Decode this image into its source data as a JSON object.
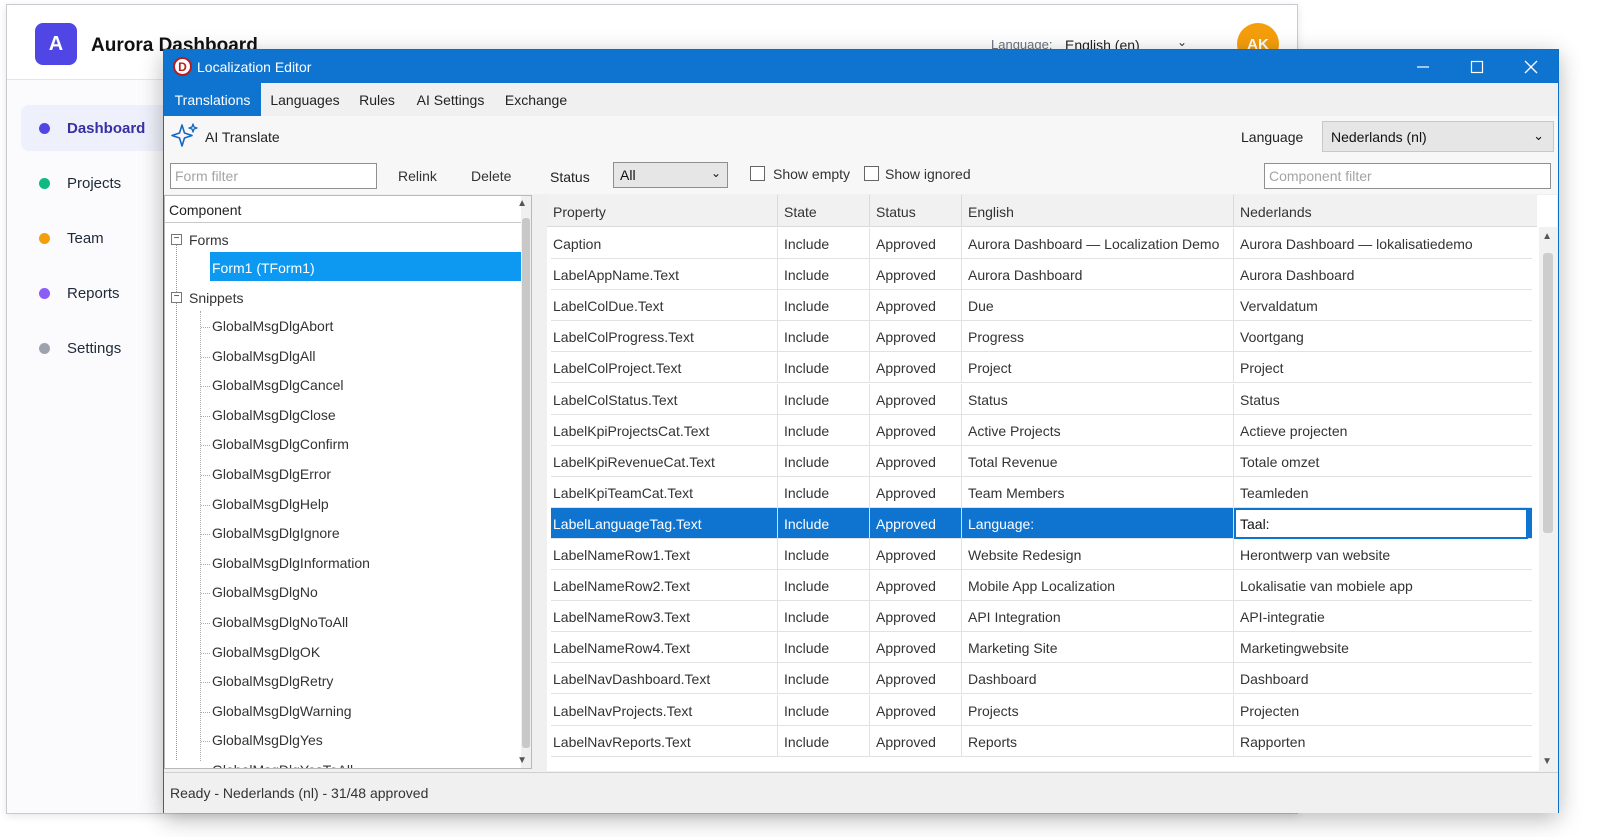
{
  "bg_app": {
    "logo_letter": "A",
    "title": "Aurora Dashboard",
    "language_label": "Language:",
    "language_value": "English (en)",
    "avatar_initials": "AK",
    "nav": [
      {
        "label": "Dashboard",
        "color": "#4f46e5",
        "active": true
      },
      {
        "label": "Projects",
        "color": "#10b981",
        "active": false
      },
      {
        "label": "Team",
        "color": "#f59e0b",
        "active": false
      },
      {
        "label": "Reports",
        "color": "#8b5cf6",
        "active": false
      },
      {
        "label": "Settings",
        "color": "#9ca3af",
        "active": false
      }
    ]
  },
  "editor": {
    "title": "Localization Editor",
    "app_icon_letter": "D",
    "tabs": [
      "Translations",
      "Languages",
      "Rules",
      "AI Settings",
      "Exchange"
    ],
    "active_tab": "Translations",
    "ai_translate_label": "AI Translate",
    "language_label": "Language",
    "language_value": "Nederlands (nl)",
    "form_filter_placeholder": "Form filter",
    "relink_label": "Relink",
    "delete_label": "Delete",
    "status_label": "Status",
    "status_value": "All",
    "show_empty_label": "Show empty",
    "show_ignored_label": "Show ignored",
    "component_filter_placeholder": "Component filter",
    "tree": {
      "header": "Component",
      "forms_label": "Forms",
      "form_item": "Form1 (TForm1)",
      "snippets_label": "Snippets",
      "snippets": [
        "GlobalMsgDlgAbort",
        "GlobalMsgDlgAll",
        "GlobalMsgDlgCancel",
        "GlobalMsgDlgClose",
        "GlobalMsgDlgConfirm",
        "GlobalMsgDlgError",
        "GlobalMsgDlgHelp",
        "GlobalMsgDlgIgnore",
        "GlobalMsgDlgInformation",
        "GlobalMsgDlgNo",
        "GlobalMsgDlgNoToAll",
        "GlobalMsgDlgOK",
        "GlobalMsgDlgRetry",
        "GlobalMsgDlgWarning",
        "GlobalMsgDlgYes",
        "GlobalMsgDlgYesToAll"
      ]
    },
    "grid": {
      "columns": [
        "Property",
        "State",
        "Status",
        "English",
        "Nederlands"
      ],
      "rows": [
        [
          "Caption",
          "Include",
          "Approved",
          "Aurora Dashboard — Localization Demo",
          "Aurora Dashboard — lokalisatiedemo"
        ],
        [
          "LabelAppName.Text",
          "Include",
          "Approved",
          "Aurora Dashboard",
          "Aurora Dashboard"
        ],
        [
          "LabelColDue.Text",
          "Include",
          "Approved",
          "Due",
          "Vervaldatum"
        ],
        [
          "LabelColProgress.Text",
          "Include",
          "Approved",
          "Progress",
          "Voortgang"
        ],
        [
          "LabelColProject.Text",
          "Include",
          "Approved",
          "Project",
          "Project"
        ],
        [
          "LabelColStatus.Text",
          "Include",
          "Approved",
          "Status",
          "Status"
        ],
        [
          "LabelKpiProjectsCat.Text",
          "Include",
          "Approved",
          "Active Projects",
          "Actieve projecten"
        ],
        [
          "LabelKpiRevenueCat.Text",
          "Include",
          "Approved",
          "Total Revenue",
          "Totale omzet"
        ],
        [
          "LabelKpiTeamCat.Text",
          "Include",
          "Approved",
          "Team Members",
          "Teamleden"
        ],
        [
          "LabelLanguageTag.Text",
          "Include",
          "Approved",
          "Language:",
          "Taal:"
        ],
        [
          "LabelNameRow1.Text",
          "Include",
          "Approved",
          "Website Redesign",
          "Herontwerp van website"
        ],
        [
          "LabelNameRow2.Text",
          "Include",
          "Approved",
          "Mobile App Localization",
          "Lokalisatie van mobiele app"
        ],
        [
          "LabelNameRow3.Text",
          "Include",
          "Approved",
          "API Integration",
          "API-integratie"
        ],
        [
          "LabelNameRow4.Text",
          "Include",
          "Approved",
          "Marketing Site",
          "Marketingwebsite"
        ],
        [
          "LabelNavDashboard.Text",
          "Include",
          "Approved",
          "Dashboard",
          "Dashboard"
        ],
        [
          "LabelNavProjects.Text",
          "Include",
          "Approved",
          "Projects",
          "Projecten"
        ],
        [
          "LabelNavReports.Text",
          "Include",
          "Approved",
          "Reports",
          "Rapporten"
        ]
      ],
      "selected_row_index": 9
    },
    "status_bar": "Ready - Nederlands (nl) - 31/48 approved"
  },
  "colors": {
    "accent": "#0e74d0",
    "tree_selection": "#0d99f2",
    "logo": "#4f46e5",
    "avatar": "#f59e0b"
  }
}
